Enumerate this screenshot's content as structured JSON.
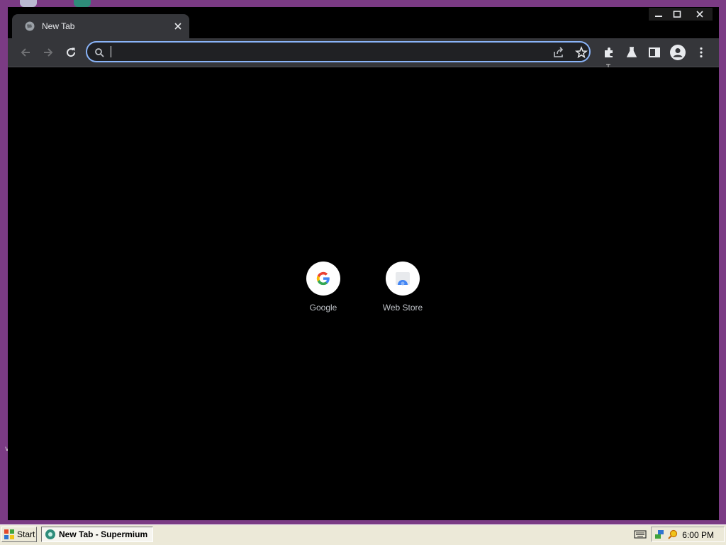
{
  "browser": {
    "tab": {
      "title": "New Tab"
    },
    "omnibox": {
      "value": "",
      "placeholder": ""
    }
  },
  "shortcuts": [
    {
      "label": "Google"
    },
    {
      "label": "Web Store"
    }
  ],
  "taskbar": {
    "start_label": "Start",
    "task_label": "New Tab - Supermium",
    "clock": "6:00 PM"
  },
  "icons": {
    "tab_favicon": "globe-icon",
    "tab_close": "close-icon",
    "back": "arrow-left-icon",
    "forward": "arrow-right-icon",
    "reload": "reload-icon",
    "search": "search-icon",
    "share": "share-icon",
    "bookmark": "star-icon",
    "extensions": "puzzle-icon",
    "labs": "flask-icon",
    "side_panel": "side-panel-icon",
    "profile": "profile-icon",
    "menu": "kebab-menu-icon"
  },
  "colors": {
    "desktop": "#7b3b84",
    "toolbar": "#35363a",
    "omnibox_focus": "#8ab4f8",
    "content_background": "#000000"
  }
}
